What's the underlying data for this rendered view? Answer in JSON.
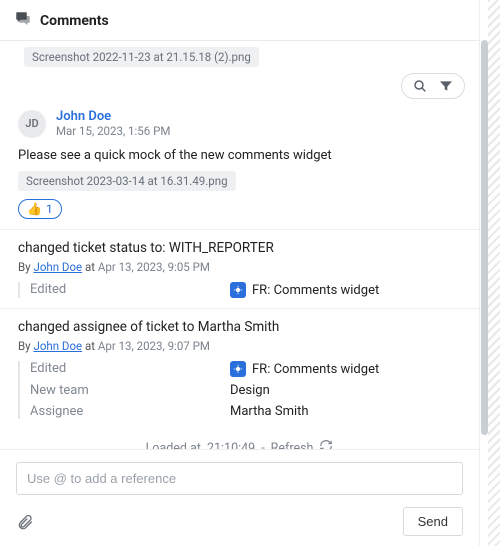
{
  "header": {
    "title": "Comments"
  },
  "top_attachment": "Screenshot 2022-11-23 at 21.15.18 (2).png",
  "comment": {
    "author_initials": "JD",
    "author": "John Doe",
    "timestamp": "Mar 15, 2023, 1:56 PM",
    "body": "Please see a quick mock of the new comments widget",
    "attachment": "Screenshot 2023-03-14 at 16.31.49.png",
    "reaction_emoji": "👍",
    "reaction_count": "1"
  },
  "events": [
    {
      "title": "changed ticket status to: WITH_REPORTER",
      "by_label": "By ",
      "who": "John Doe",
      "at_label": " at ",
      "when": "Apr 13, 2023, 9:05 PM",
      "rows": [
        {
          "key": "Edited",
          "tracker": true,
          "val": "FR: Comments widget"
        }
      ]
    },
    {
      "title": "changed assignee of ticket to Martha Smith",
      "by_label": "By ",
      "who": "John Doe",
      "at_label": " at ",
      "when": "Apr 13, 2023, 9:07 PM",
      "rows": [
        {
          "key": "Edited",
          "tracker": true,
          "val": "FR: Comments widget"
        },
        {
          "key": "New team",
          "tracker": false,
          "val": "Design"
        },
        {
          "key": "Assignee",
          "tracker": false,
          "val": "Martha Smith"
        }
      ]
    }
  ],
  "loaded": {
    "prefix": "Loaded at ",
    "time": "21:10:49",
    "sep": " - ",
    "refresh": "Refresh"
  },
  "footer": {
    "placeholder": "Use @ to add a reference",
    "send": "Send"
  }
}
